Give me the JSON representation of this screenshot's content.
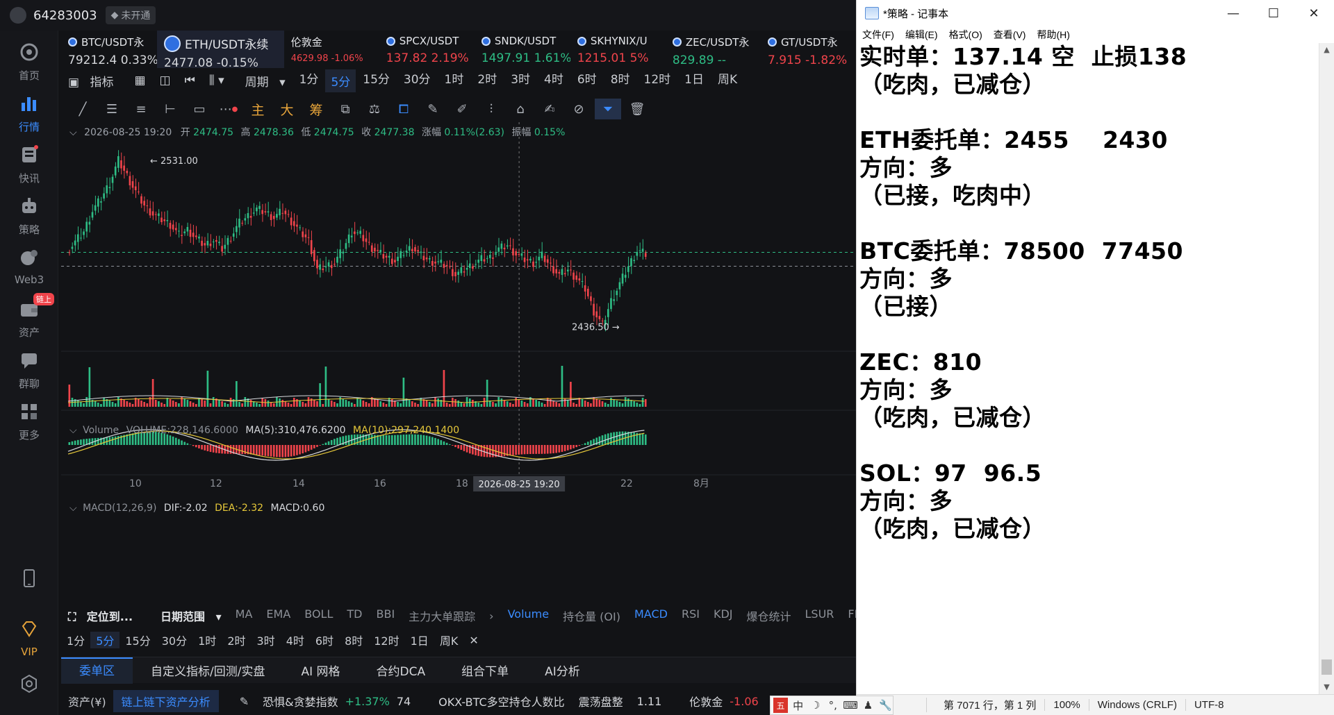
{
  "app": {
    "user_id": "64283003",
    "badge": "未开通",
    "sidebar": [
      {
        "id": "home",
        "label": "首页",
        "icon": "home-icon"
      },
      {
        "id": "market",
        "label": "行情",
        "icon": "bar-chart-icon",
        "active": true
      },
      {
        "id": "news",
        "label": "快讯",
        "icon": "news-icon"
      },
      {
        "id": "strategy",
        "label": "策略",
        "icon": "robot-icon"
      },
      {
        "id": "web3",
        "label": "Web3",
        "icon": "web3-icon"
      },
      {
        "id": "assets",
        "label": "资产",
        "icon": "wallet-icon",
        "tag": "链上"
      },
      {
        "id": "chat",
        "label": "群聊",
        "icon": "chat-icon"
      },
      {
        "id": "more",
        "label": "更多",
        "icon": "grid-icon"
      }
    ],
    "sidebar_bottom": {
      "vip": "VIP"
    }
  },
  "tickers": [
    {
      "name": "BTC/USDT永",
      "price": "79212.4",
      "change": "0.33%",
      "dir": "wh"
    },
    {
      "name": "ETH/USDT永续",
      "price": "2477.08",
      "change": "-0.15%",
      "dir": "wh",
      "selected": true
    },
    {
      "name": "伦敦金",
      "price": "4629.98",
      "change": "-1.06%",
      "dir": "dn",
      "gold": true
    },
    {
      "name": "SPCX/USDT",
      "price": "137.82",
      "change": "2.19%",
      "dir": "dn"
    },
    {
      "name": "SNDK/USDT",
      "price": "1497.91",
      "change": "1.61%",
      "dir": "up"
    },
    {
      "name": "SKHYNIX/U",
      "price": "1215.01",
      "change": "5%",
      "dir": "dn"
    },
    {
      "name": "ZEC/USDT永",
      "price": "829.89",
      "change": "--",
      "dir": "up"
    },
    {
      "name": "GT/USDT永",
      "price": "7.915",
      "change": "-1.82%",
      "dir": "dn"
    }
  ],
  "toolbar1": {
    "indicator": "指标",
    "period": "周期",
    "periods": [
      "1分",
      "5分",
      "15分",
      "30分",
      "1时",
      "2时",
      "3时",
      "4时",
      "6时",
      "8时",
      "12时",
      "1日",
      "周K"
    ],
    "active": "5分"
  },
  "toolbar2": {
    "zhu": "主",
    "da": "大",
    "chou": "筹"
  },
  "ohlc_bar": {
    "date": "2026-08-25 19:20",
    "open_label": "开",
    "open": "2474.75",
    "high_label": "高",
    "high": "2478.36",
    "low_label": "低",
    "low": "2474.75",
    "close_label": "收",
    "close": "2477.38",
    "chg_label": "涨幅",
    "chg": "0.11%(2.63)",
    "amp_label": "振幅",
    "amp": "0.15%"
  },
  "volume_info": {
    "label": "Volume",
    "vol": "VOLUME:228,146.6000",
    "ma5": "MA(5):310,476.6200",
    "ma10": "MA(10):297,240.1400"
  },
  "macd_info": {
    "label": "MACD(12,26,9)",
    "dif": "DIF:-2.02",
    "dea": "DEA:-2.32",
    "macd": "MACD:0.60"
  },
  "chart_data": {
    "type": "candlestick",
    "symbol": "ETH/USDT永续",
    "interval": "5分",
    "x_ticks": [
      "10",
      "12",
      "14",
      "16",
      "18",
      "22",
      "8月"
    ],
    "crosshair_label": "2026-08-25 19:20",
    "annotations": [
      {
        "text": "← 2531.00"
      },
      {
        "text": "2436.50 →"
      }
    ],
    "ylim": [
      2425,
      2545
    ],
    "series": [
      {
        "name": "price",
        "values": [
          2478,
          2484,
          2490,
          2502,
          2509,
          2518,
          2531,
          2522,
          2513,
          2505,
          2500,
          2497,
          2494,
          2488,
          2491,
          2486,
          2482,
          2485,
          2480,
          2487,
          2495,
          2499,
          2503,
          2501,
          2498,
          2502,
          2496,
          2490,
          2485,
          2468,
          2470,
          2472,
          2480,
          2490,
          2488,
          2482,
          2478,
          2475,
          2473,
          2478,
          2481,
          2476,
          2473,
          2472,
          2470,
          2465,
          2468,
          2471,
          2474,
          2475,
          2480,
          2482,
          2477,
          2474,
          2472,
          2476,
          2470,
          2465,
          2468,
          2463,
          2457,
          2444,
          2436,
          2450,
          2460,
          2470,
          2479,
          2477
        ]
      }
    ]
  },
  "indicator_bar": {
    "locate": "定位到...",
    "date_range": "日期范围",
    "items": [
      "MA",
      "EMA",
      "BOLL",
      "TD",
      "BBI",
      "主力大单跟踪"
    ],
    "sub": [
      "Volume",
      "持仓量 (OI)",
      "MACD",
      "RSI",
      "KDJ",
      "爆仓统计",
      "LSUR",
      "FR"
    ]
  },
  "period_bar2": {
    "periods": [
      "1分",
      "5分",
      "15分",
      "30分",
      "1时",
      "2时",
      "3时",
      "4时",
      "6时",
      "8时",
      "12时",
      "1日",
      "周K"
    ],
    "active": "5分"
  },
  "bottom_tabs": [
    "委单区",
    "自定义指标/回测/实盘",
    "AI 网格",
    "合约DCA",
    "组合下单",
    "AI分析"
  ],
  "status": {
    "assets": "资产(¥)",
    "analysis": "链上链下资产分析",
    "fear_label": "恐惧&贪婪指数",
    "fear_chg": "+1.37%",
    "fear_val": "74",
    "okx_label": "OKX-BTC多空持仓人数比",
    "okx_state": "震荡盘整",
    "okx_val": "1.11",
    "gold_label": "伦敦金",
    "gold_chg": "-1.06"
  },
  "notepad": {
    "title": "*策略 - 记事本",
    "menu": [
      "文件(F)",
      "编辑(E)",
      "格式(O)",
      "查看(V)",
      "帮助(H)"
    ],
    "content": "实时单：137.14 空  止损138\n（吃肉，已减仓）\n\nETH委托单：2455    2430\n方向：多\n（已接，吃肉中）\n\nBTC委托单：78500  77450\n方向：多\n（已接）\n\nZEC：810\n方向：多\n（吃肉，已减仓）\n\nSOL：97  96.5\n方向：多\n（吃肉，已减仓）",
    "status_pos": "第 7071 行，第 1 列",
    "zoom": "100%",
    "eol": "Windows (CRLF)",
    "enc": "UTF-8"
  },
  "ime": {
    "cn": "中"
  }
}
